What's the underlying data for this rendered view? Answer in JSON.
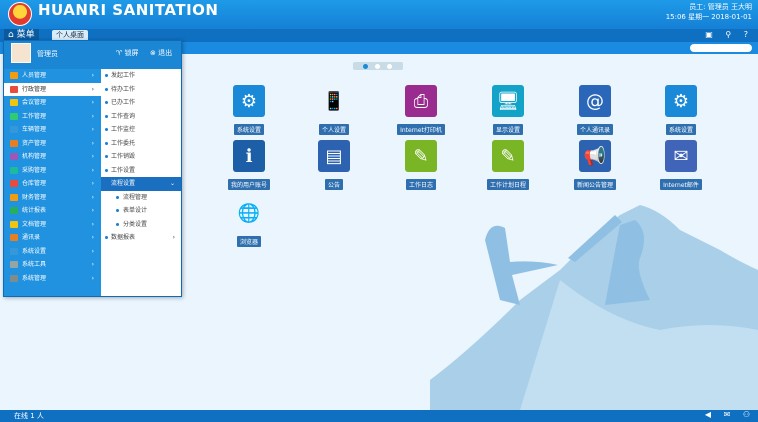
{
  "header": {
    "brand": "HUANRI SANITATION",
    "user_line1": "员工: 管理员 王大明",
    "user_line2": "15:06 星期一 2018-01-01"
  },
  "nav": {
    "menu_label": "菜单",
    "home_tab": "个人桌面"
  },
  "side_menu": {
    "user_name": "管理员",
    "lock_label": "锁屏",
    "logout_label": "退出",
    "left_items": [
      {
        "label": "人员管理",
        "color": "#f39c12"
      },
      {
        "label": "行政管理",
        "color": "#e74c3c"
      },
      {
        "label": "会议管理",
        "color": "#f1c40f"
      },
      {
        "label": "工作管理",
        "color": "#2ecc71"
      },
      {
        "label": "车辆管理",
        "color": "#3498db"
      },
      {
        "label": "资产管理",
        "color": "#e67e22"
      },
      {
        "label": "机构管理",
        "color": "#9b59b6"
      },
      {
        "label": "采购管理",
        "color": "#1abc9c"
      },
      {
        "label": "仓库管理",
        "color": "#e74c3c"
      },
      {
        "label": "财务管理",
        "color": "#f39c12"
      },
      {
        "label": "统计报表",
        "color": "#27ae60"
      },
      {
        "label": "文档管理",
        "color": "#f1c40f"
      },
      {
        "label": "通讯录",
        "color": "#e67e22"
      },
      {
        "label": "系统设置",
        "color": "#3498db"
      },
      {
        "label": "系统工具",
        "color": "#95a5a6"
      },
      {
        "label": "系统管理",
        "color": "#7f8c8d"
      }
    ],
    "right_items": [
      {
        "label": "发起工作",
        "type": "normal"
      },
      {
        "label": "待办工作",
        "type": "normal"
      },
      {
        "label": "已办工作",
        "type": "normal"
      },
      {
        "label": "工作查询",
        "type": "normal"
      },
      {
        "label": "工作监控",
        "type": "normal"
      },
      {
        "label": "工作委托",
        "type": "normal"
      },
      {
        "label": "工作销毁",
        "type": "normal"
      },
      {
        "label": "工作设置",
        "type": "normal"
      },
      {
        "label": "流程设置",
        "type": "hl"
      },
      {
        "label": "流程管理",
        "type": "sub"
      },
      {
        "label": "表单设计",
        "type": "sub"
      },
      {
        "label": "分类设置",
        "type": "sub"
      },
      {
        "label": "数据报表",
        "type": "arrow"
      }
    ]
  },
  "apps": [
    {
      "label": "系统设置",
      "color": "#1a8ad8",
      "icon": "gear-icon",
      "glyph": "⚙"
    },
    {
      "label": "个人设置",
      "color": "#d0e6f5",
      "icon": "phone-icon",
      "glyph": "📱"
    },
    {
      "label": "Internet打印机",
      "color": "#9b2c8f",
      "icon": "printer-icon",
      "glyph": "⎙"
    },
    {
      "label": "显示设置",
      "color": "#13a3c8",
      "icon": "monitor-icon",
      "glyph": "🖥"
    },
    {
      "label": "个人通讯录",
      "color": "#2a67b8",
      "icon": "address-book-icon",
      "glyph": "@"
    },
    {
      "label": "系统设置",
      "color": "#1a8ad8",
      "icon": "gear-icon",
      "glyph": "⚙"
    },
    {
      "label": "我的用户账号",
      "color": "#1c5fa6",
      "icon": "user-info-icon",
      "glyph": "ℹ"
    },
    {
      "label": "公告",
      "color": "#2d62b0",
      "icon": "bag-icon",
      "glyph": "▤"
    },
    {
      "label": "工作日志",
      "color": "#7ab526",
      "icon": "notepad-icon",
      "glyph": "✎"
    },
    {
      "label": "工作计划日程",
      "color": "#7ab526",
      "icon": "notepad-icon",
      "glyph": "✎"
    },
    {
      "label": "新闻公告管理",
      "color": "#2d62b0",
      "icon": "megaphone-icon",
      "glyph": "📢"
    },
    {
      "label": "Internet邮件",
      "color": "#3f64b8",
      "icon": "mail-icon",
      "glyph": "✉"
    },
    {
      "label": "浏览器",
      "color": "#ffffff",
      "icon": "globe-icon",
      "glyph": "🌐"
    }
  ],
  "status": {
    "online": "在线 1 人"
  }
}
